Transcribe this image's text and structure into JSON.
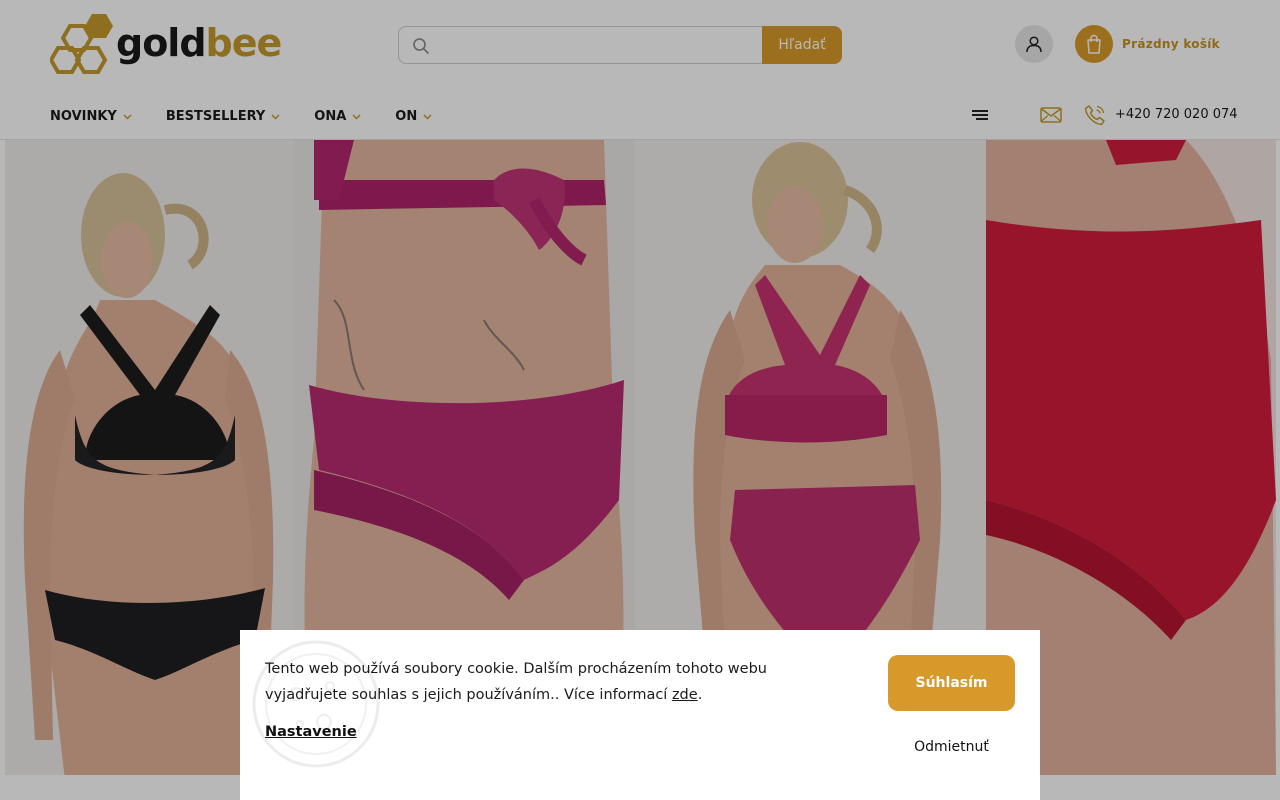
{
  "brand": {
    "word1": "gold",
    "word2": "bee",
    "accent": "#d79a2a"
  },
  "search": {
    "placeholder": "",
    "button_label": "Hľadať",
    "icon": "search-icon"
  },
  "header_actions": {
    "user_icon": "user-icon",
    "cart_icon": "shopping-bag-icon",
    "cart_label": "Prázdny košík"
  },
  "nav": {
    "items": [
      {
        "label": "NOVINKY"
      },
      {
        "label": "BESTSELLERY"
      },
      {
        "label": "ONA"
      },
      {
        "label": "ON"
      }
    ],
    "menu_icon": "hamburger-menu-icon",
    "mail_icon": "mail-icon",
    "phone_icon": "phone-icon",
    "phone": "+420 720 020 074"
  },
  "hero": {
    "panels": [
      {
        "name": "black-velvet-halter-bikini"
      },
      {
        "name": "pink-velvet-bikini-back"
      },
      {
        "name": "pink-velvet-halter-set"
      },
      {
        "name": "red-velvet-highwaist-back"
      }
    ]
  },
  "cookie": {
    "text_before_link": "Tento web používá soubory cookie. Dalším procházením tohoto webu vyjadřujete souhlas s jejich používáním.. Více informací ",
    "link_label": "zde",
    "text_after_link": ".",
    "settings_label": "Nastavenie",
    "accept_label": "Súhlasím",
    "reject_label": "Odmietnuť"
  }
}
